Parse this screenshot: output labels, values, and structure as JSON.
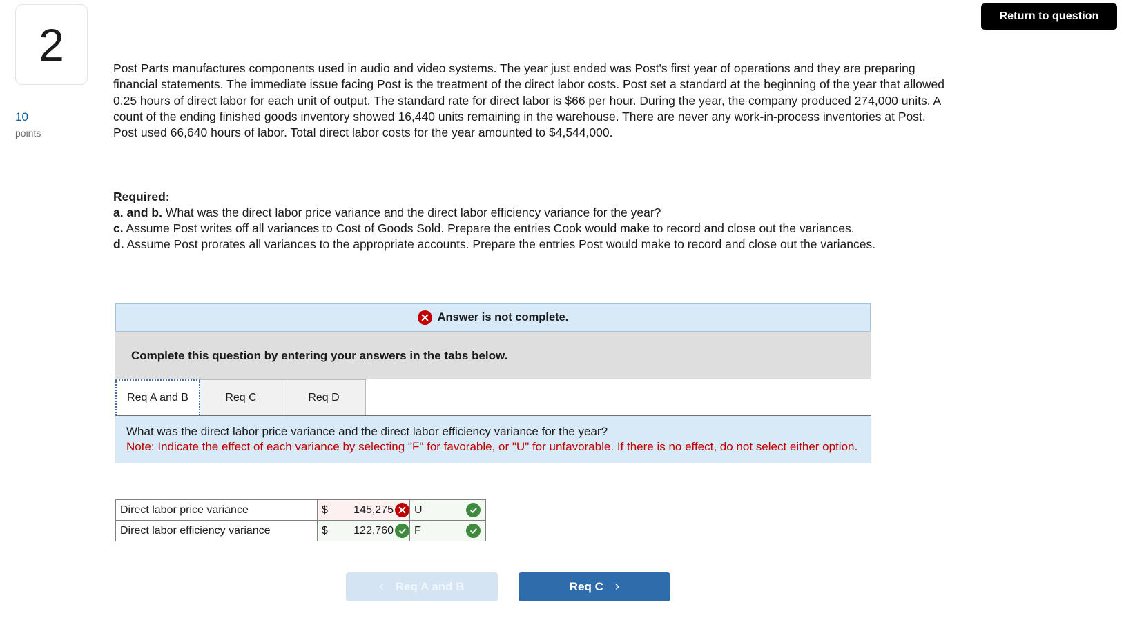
{
  "header": {
    "return_button_label": "Return to question"
  },
  "question_meta": {
    "number": "2",
    "points_value": "10",
    "points_label": "points"
  },
  "stem": {
    "text": "Post Parts manufactures components used in audio and video systems. The year just ended was Post's first year of operations and they are preparing financial statements. The immediate issue facing Post is the treatment of the direct labor costs. Post set a standard at the beginning of the year that allowed 0.25 hours of direct labor for each unit of output. The standard rate for direct labor is $66 per hour. During the year, the company produced 274,000 units. A count of the ending finished goods inventory showed 16,440 units remaining in the warehouse. There are never any work-in-process inventories at Post. Post used 66,640 hours of labor. Total direct labor costs for the year amounted to $4,544,000."
  },
  "required": {
    "heading": "Required:",
    "items": [
      {
        "marker": "a. and b.",
        "text": "What was the direct labor price variance and the direct labor efficiency variance for the year?"
      },
      {
        "marker": "c.",
        "text": "Assume Post writes off all variances to Cost of Goods Sold. Prepare the entries Cook would make to record and close out the variances."
      },
      {
        "marker": "d.",
        "text": "Assume Post prorates all variances to the appropriate accounts. Prepare the entries Post would make to record and close out the variances."
      }
    ]
  },
  "widget": {
    "alert": {
      "icon": "error-circle-icon",
      "text": "Answer is not complete."
    },
    "instruction": "Complete this question by entering your answers in the tabs below.",
    "tabs": [
      {
        "label": "Req A and B",
        "active": true
      },
      {
        "label": "Req C",
        "active": false
      },
      {
        "label": "Req D",
        "active": false
      }
    ],
    "question_panel": {
      "title": "What was the direct labor price variance and the direct labor efficiency variance for the year?",
      "note": "Note: Indicate the effect of each variance by selecting \"F\" for favorable, or \"U\" for unfavorable. If there is no effect, do not select either option."
    },
    "answer_table": {
      "rows": [
        {
          "label": "Direct labor price variance",
          "currency": "$",
          "amount": "145,275",
          "amount_status": "incorrect",
          "flag": "U",
          "flag_status": "correct"
        },
        {
          "label": "Direct labor efficiency variance",
          "currency": "$",
          "amount": "122,760",
          "amount_status": "correct",
          "flag": "F",
          "flag_status": "correct"
        }
      ]
    },
    "nav": {
      "prev_label": "Req A and B",
      "prev_icon": "chevron-left-icon",
      "next_label": "Req C",
      "next_icon": "chevron-right-icon"
    }
  },
  "colors": {
    "alert_bg": "#d8e9f7",
    "instruction_bg": "#dedede",
    "panel_bg": "#d8e9f7",
    "note_red": "#c00000",
    "correct_green": "#3f8a3f",
    "incorrect_red": "#c00000",
    "primary_blue": "#2f6cab",
    "points_blue": "#0b5a9e"
  }
}
